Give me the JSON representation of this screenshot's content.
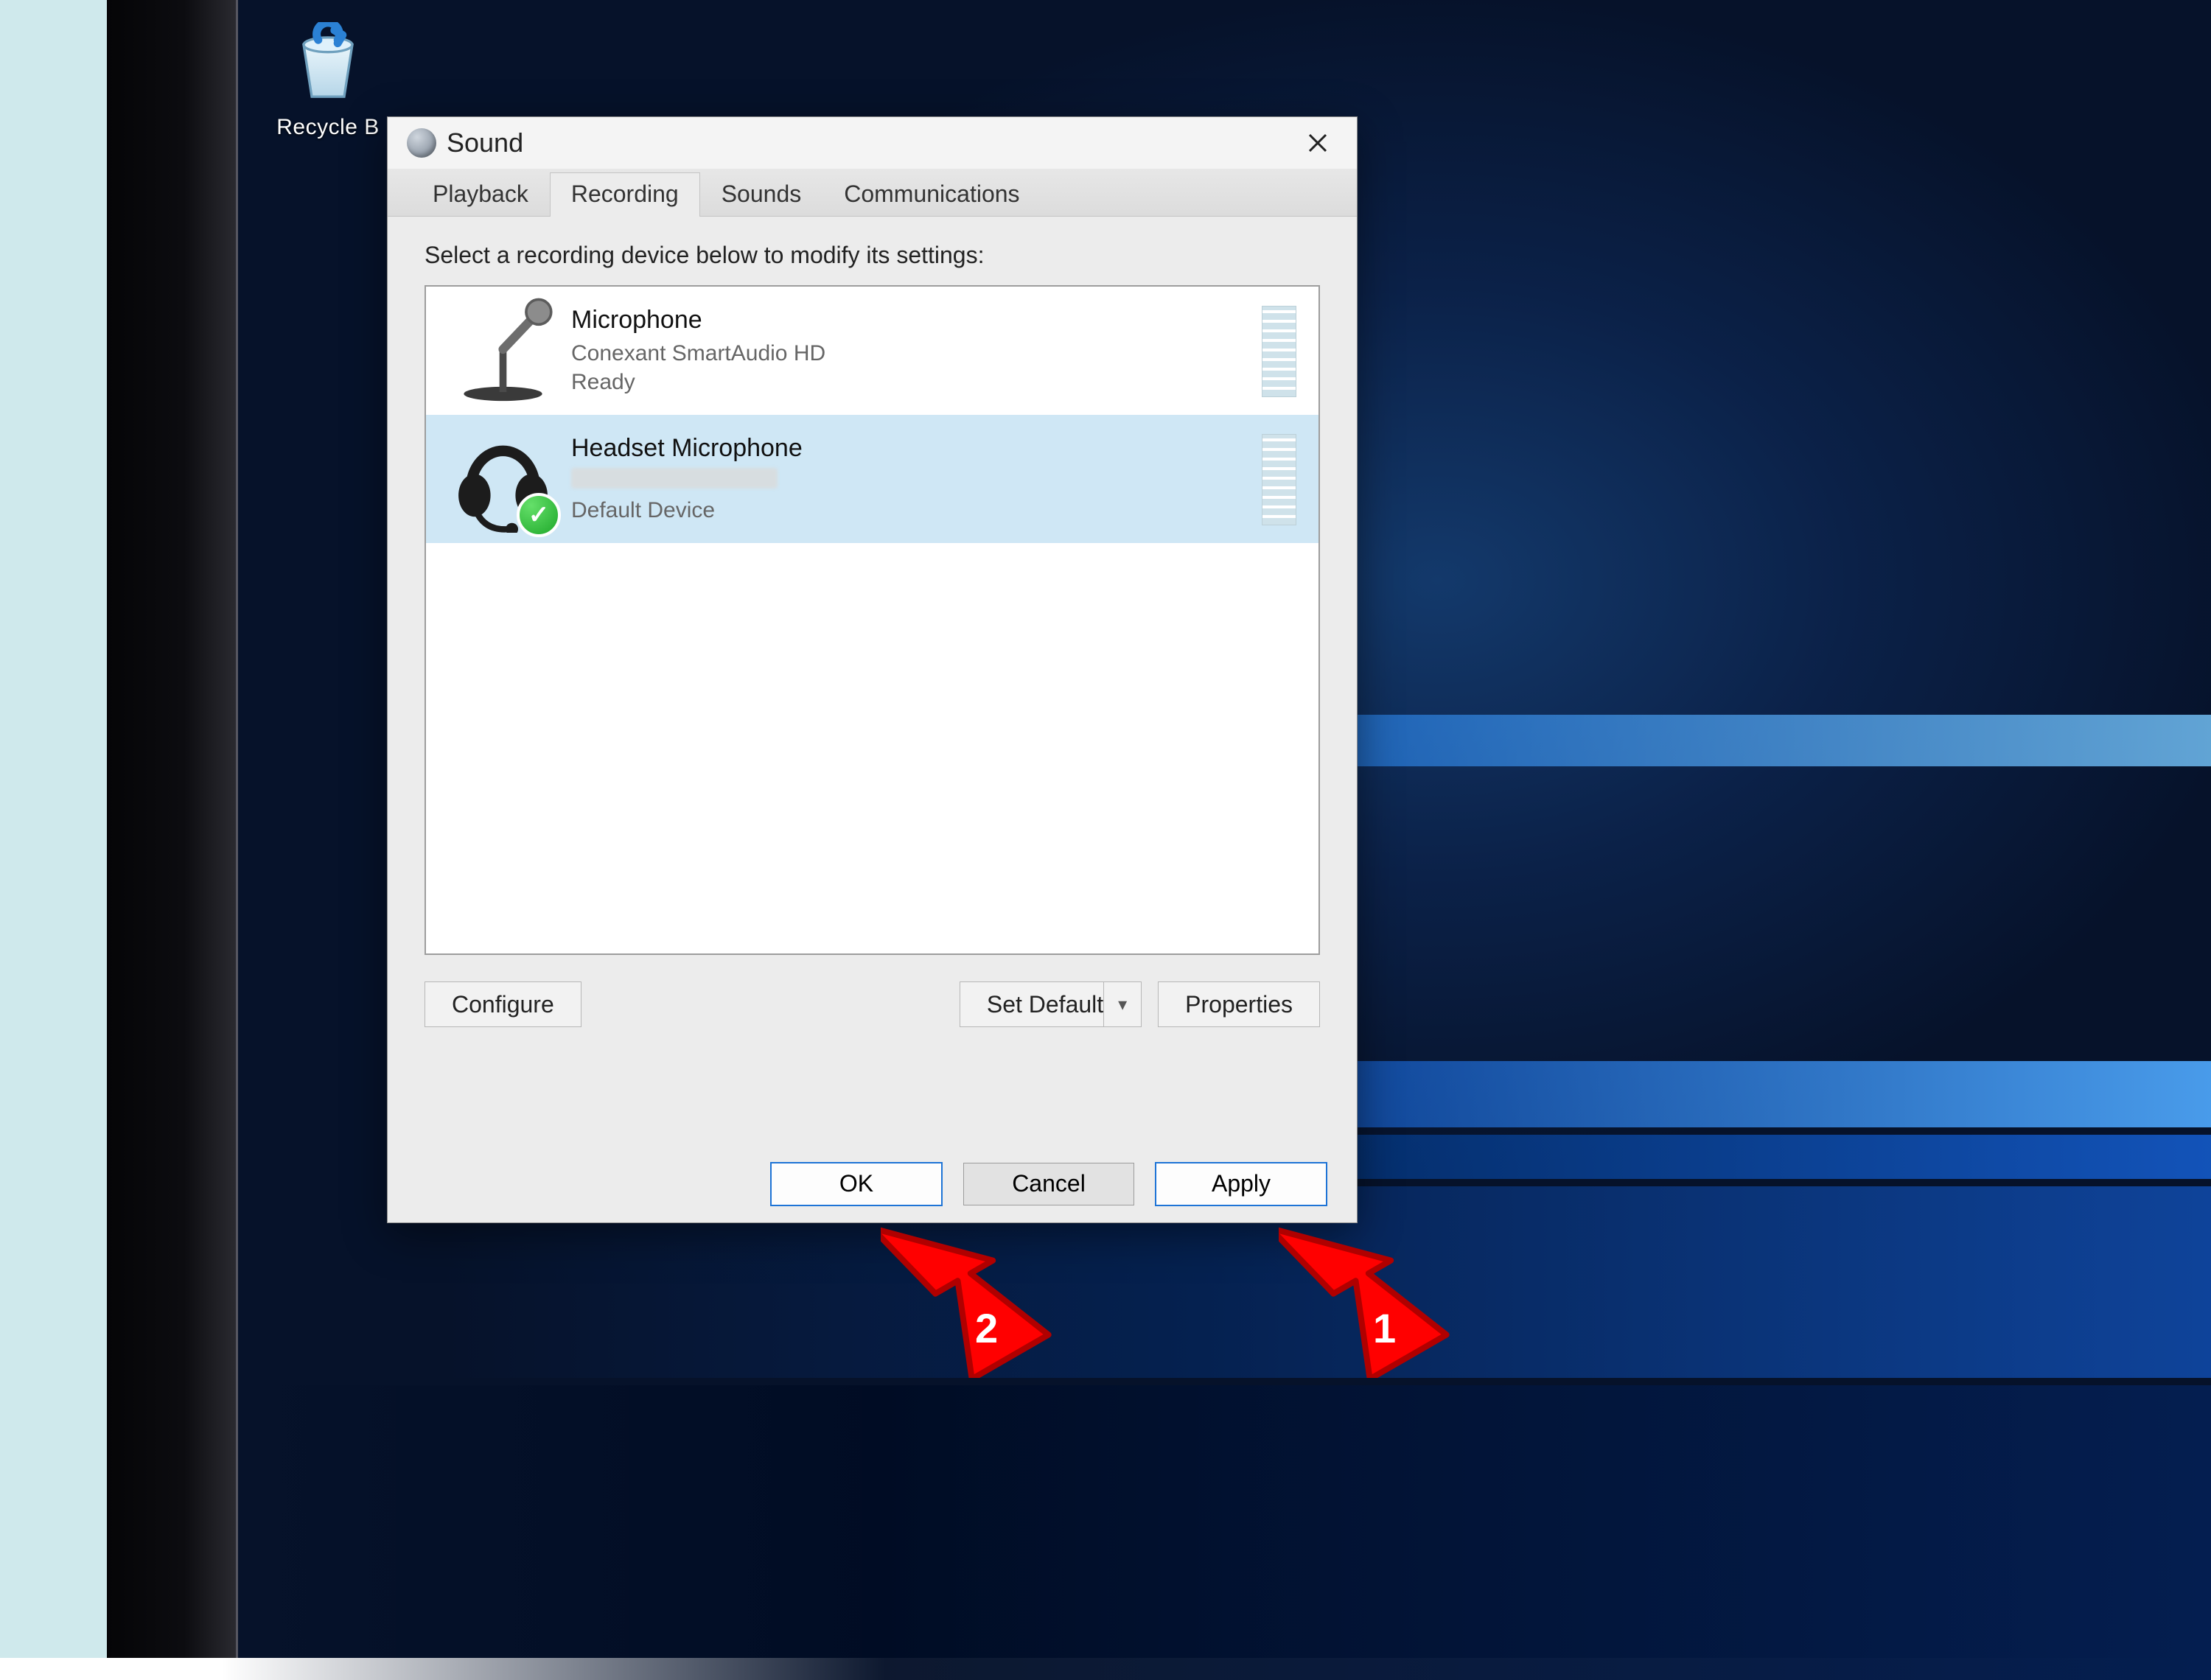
{
  "desktop": {
    "recycle_bin_label": "Recycle B"
  },
  "window": {
    "title": "Sound",
    "tabs": [
      "Playback",
      "Recording",
      "Sounds",
      "Communications"
    ],
    "active_tab_index": 1,
    "instruction": "Select a recording device below to modify its settings:",
    "devices": [
      {
        "name": "Microphone",
        "driver": "Conexant SmartAudio HD",
        "status": "Ready",
        "selected": false,
        "default": false
      },
      {
        "name": "Headset Microphone",
        "driver": "",
        "status": "Default Device",
        "selected": true,
        "default": true
      }
    ],
    "buttons": {
      "configure": "Configure",
      "set_default": "Set Default",
      "properties": "Properties",
      "ok": "OK",
      "cancel": "Cancel",
      "apply": "Apply"
    }
  },
  "callouts": {
    "arrow1_num": "1",
    "arrow2_num": "2"
  }
}
